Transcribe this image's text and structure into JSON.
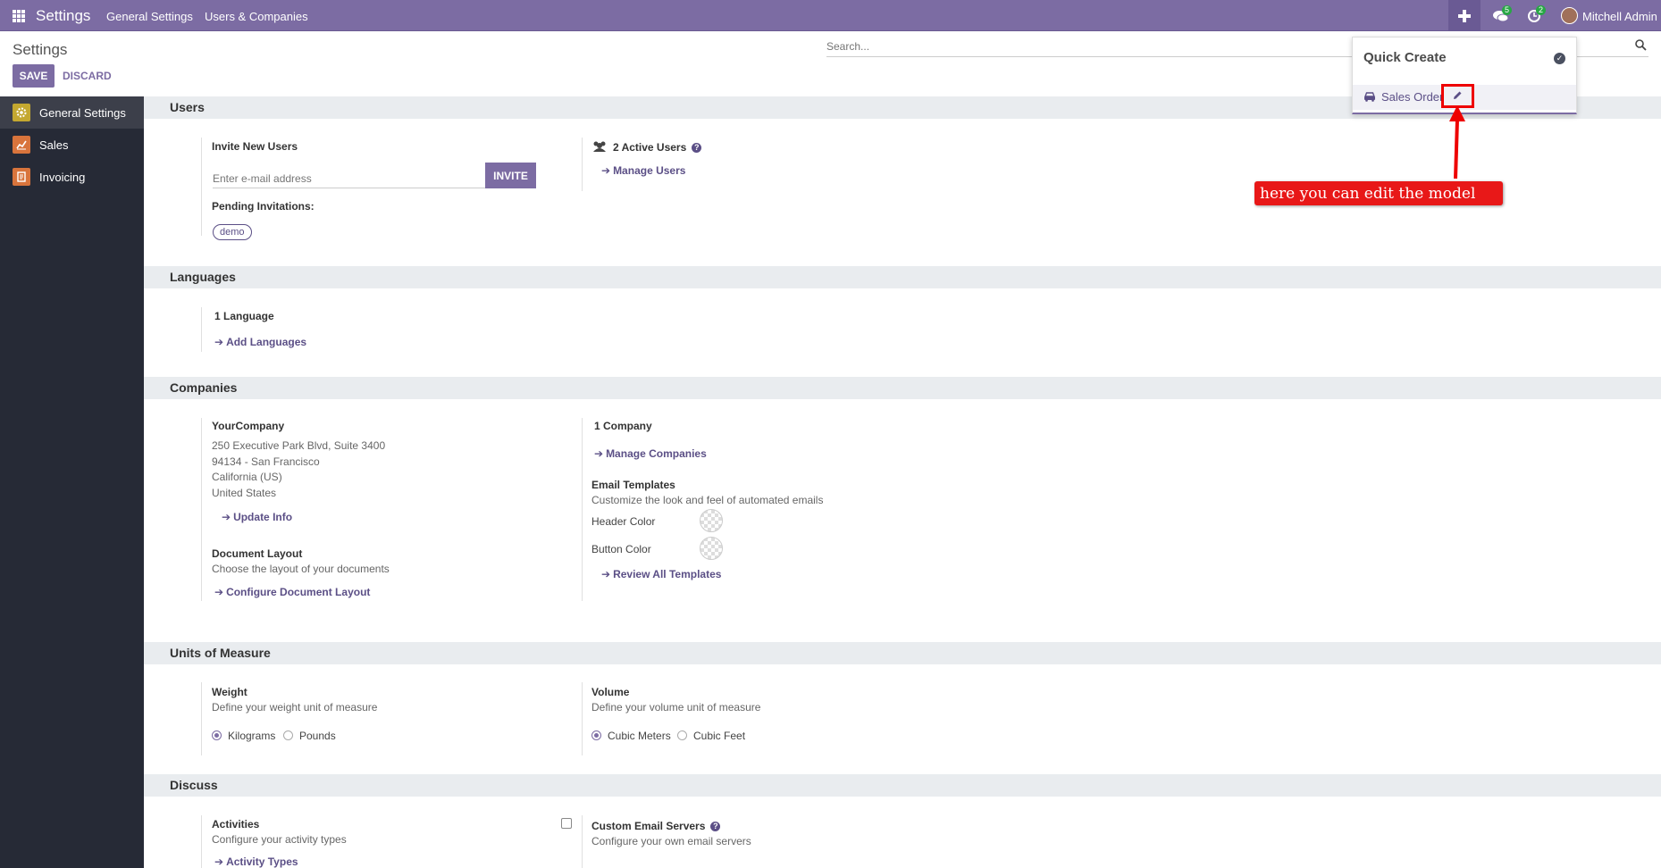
{
  "navbar": {
    "app_title": "Settings",
    "menu": [
      "General Settings",
      "Users & Companies"
    ],
    "messages_badge": "5",
    "activities_badge": "2",
    "user_name": "Mitchell Admin"
  },
  "control_panel": {
    "breadcrumb": "Settings",
    "search_placeholder": "Search...",
    "save_label": "SAVE",
    "discard_label": "DISCARD"
  },
  "sidebar": {
    "items": [
      {
        "label": "General Settings",
        "icon": "gear-icon",
        "color": "#c4a830",
        "active": true
      },
      {
        "label": "Sales",
        "icon": "chart-line-icon",
        "color": "#d8743c",
        "active": false
      },
      {
        "label": "Invoicing",
        "icon": "invoice-icon",
        "color": "#d8743c",
        "active": false
      }
    ]
  },
  "sections": {
    "users": {
      "title": "Users",
      "invite_label": "Invite New Users",
      "email_placeholder": "Enter e-mail address",
      "invite_button": "INVITE",
      "pending_label": "Pending Invitations:",
      "pending_tag": "demo",
      "active_users": "2 Active Users",
      "manage_users": "Manage Users"
    },
    "languages": {
      "title": "Languages",
      "count": "1 Language",
      "add_link": "Add Languages"
    },
    "companies": {
      "title": "Companies",
      "company_name": "YourCompany",
      "address_lines": [
        "250 Executive Park Blvd, Suite 3400",
        "94134 - San Francisco",
        "California (US)",
        "United States"
      ],
      "update_info": "Update Info",
      "doc_layout_title": "Document Layout",
      "doc_layout_desc": "Choose the layout of your documents",
      "configure_doc_layout": "Configure Document Layout",
      "company_count": "1 Company",
      "manage_companies": "Manage Companies",
      "email_templates_title": "Email Templates",
      "email_templates_desc": "Customize the look and feel of automated emails",
      "header_color": "Header Color",
      "button_color": "Button Color",
      "review_templates": "Review All Templates"
    },
    "uom": {
      "title": "Units of Measure",
      "weight_title": "Weight",
      "weight_desc": "Define your weight unit of measure",
      "weight_options": [
        "Kilograms",
        "Pounds"
      ],
      "volume_title": "Volume",
      "volume_desc": "Define your volume unit of measure",
      "volume_options": [
        "Cubic Meters",
        "Cubic Feet"
      ]
    },
    "discuss": {
      "title": "Discuss",
      "activities_title": "Activities",
      "activities_desc": "Configure your activity types",
      "activity_types": "Activity Types",
      "mail_servers_title": "Custom Email Servers",
      "mail_servers_desc": "Configure your own email servers"
    }
  },
  "quick_create": {
    "title": "Quick Create",
    "item_label": "Sales Order"
  },
  "annotation": {
    "text": "here you can edit the model",
    "color": "#e81818"
  }
}
